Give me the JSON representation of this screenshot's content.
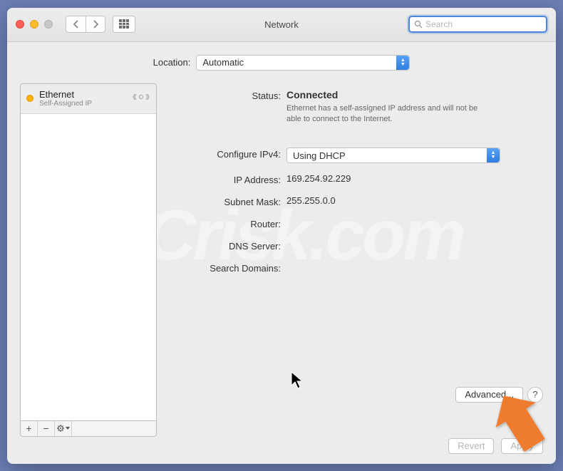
{
  "window": {
    "title": "Network"
  },
  "search": {
    "placeholder": "Search",
    "value": ""
  },
  "location": {
    "label": "Location:",
    "selected": "Automatic"
  },
  "sidebar": {
    "items": [
      {
        "name": "Ethernet",
        "sub": "Self-Assigned IP",
        "status": "orange"
      }
    ]
  },
  "fields": {
    "status_label": "Status:",
    "status_value": "Connected",
    "status_msg": "Ethernet has a self-assigned IP address and will not be able to connect to the Internet.",
    "configure_label": "Configure IPv4:",
    "configure_value": "Using DHCP",
    "ip_label": "IP Address:",
    "ip_value": "169.254.92.229",
    "subnet_label": "Subnet Mask:",
    "subnet_value": "255.255.0.0",
    "router_label": "Router:",
    "router_value": "",
    "dns_label": "DNS Server:",
    "dns_value": "",
    "domains_label": "Search Domains:",
    "domains_value": ""
  },
  "buttons": {
    "advanced": "Advanced...",
    "help": "?",
    "revert": "Revert",
    "apply": "Apply"
  },
  "watermark": "PCrisk.com"
}
